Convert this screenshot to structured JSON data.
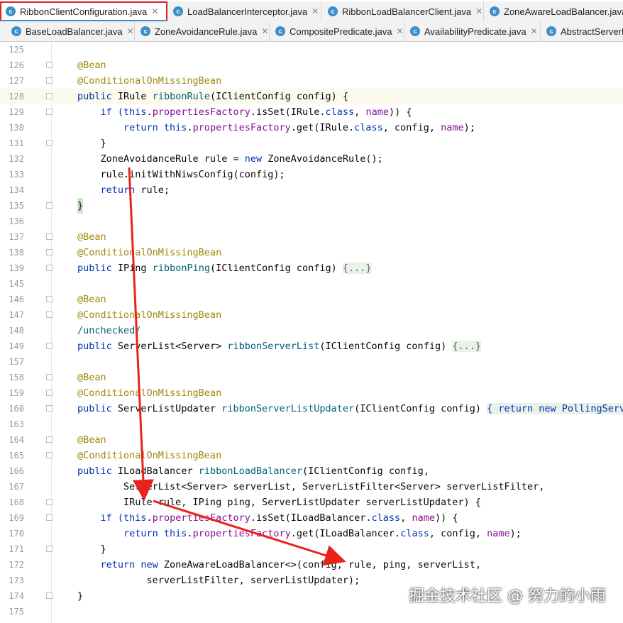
{
  "tabs_row1": [
    {
      "label": "RibbonClientConfiguration.java",
      "active": true
    },
    {
      "label": "LoadBalancerInterceptor.java"
    },
    {
      "label": "RibbonLoadBalancerClient.java"
    },
    {
      "label": "ZoneAwareLoadBalancer.java"
    }
  ],
  "tabs_row2": [
    {
      "label": "BaseLoadBalancer.java"
    },
    {
      "label": "ZoneAvoidanceRule.java"
    },
    {
      "label": "CompositePredicate.java"
    },
    {
      "label": "AvailabilityPredicate.java"
    },
    {
      "label": "AbstractServerP"
    }
  ],
  "line_numbers": [
    "125",
    "126",
    "127",
    "128",
    "129",
    "130",
    "131",
    "132",
    "133",
    "134",
    "135",
    "136",
    "137",
    "138",
    "139",
    "145",
    "146",
    "147",
    "148",
    "149",
    "157",
    "158",
    "159",
    "160",
    "163",
    "164",
    "165",
    "166",
    "167",
    "168",
    "169",
    "170",
    "171",
    "172",
    "173",
    "174",
    "175"
  ],
  "code": {
    "l126": "@Bean",
    "l127": "@ConditionalOnMissingBean",
    "l128_a": "public",
    "l128_b": " IRule ",
    "l128_c": "ribbonRule",
    "l128_d": "(IClientConfig config) {",
    "l129_a": "    if (",
    "l129_b": "this",
    "l129_c": ".",
    "l129_d": "propertiesFactory",
    "l129_e": ".isSet(IRule.",
    "l129_f": "class",
    "l129_g": ", ",
    "l129_h": "name",
    "l129_i": ")) {",
    "l130_a": "        return ",
    "l130_b": "this",
    "l130_c": ".",
    "l130_d": "propertiesFactory",
    "l130_e": ".get(IRule.",
    "l130_f": "class",
    "l130_g": ", config, ",
    "l130_h": "name",
    "l130_i": ");",
    "l131": "    }",
    "l132_a": "    ZoneAvoidanceRule rule = ",
    "l132_b": "new",
    "l132_c": " ZoneAvoidanceRule();",
    "l133": "    rule.initWithNiwsConfig(config);",
    "l134_a": "    return",
    "l134_b": " rule;",
    "l135": "}",
    "l137": "@Bean",
    "l138": "@ConditionalOnMissingBean",
    "l139_a": "public",
    "l139_b": " IPing ",
    "l139_c": "ribbonPing",
    "l139_d": "(IClientConfig config) ",
    "l139_e": "{...}",
    "l146": "@Bean",
    "l147": "@ConditionalOnMissingBean",
    "l148": "/unchecked/",
    "l149_a": "public",
    "l149_b": " ServerList<Server> ",
    "l149_c": "ribbonServerList",
    "l149_d": "(IClientConfig config) ",
    "l149_e": "{...}",
    "l158": "@Bean",
    "l159": "@ConditionalOnMissingBean",
    "l160_a": "public",
    "l160_b": " ServerListUpdater ",
    "l160_c": "ribbonServerListUpdater",
    "l160_d": "(IClientConfig config) ",
    "l160_e": "{ return new PollingServe",
    "l164": "@Bean",
    "l165": "@ConditionalOnMissingBean",
    "l166_a": "public",
    "l166_b": " ILoadBalancer ",
    "l166_c": "ribbonLoadBalancer",
    "l166_d": "(IClientConfig config,",
    "l167": "        ServerList<Server> serverList, ServerListFilter<Server> serverListFilter,",
    "l168": "        IRule rule, IPing ping, ServerListUpdater serverListUpdater) {",
    "l169_a": "    if (",
    "l169_b": "this",
    "l169_c": ".",
    "l169_d": "propertiesFactory",
    "l169_e": ".isSet(ILoadBalancer.",
    "l169_f": "class",
    "l169_g": ", ",
    "l169_h": "name",
    "l169_i": ")) {",
    "l170_a": "        return ",
    "l170_b": "this",
    "l170_c": ".",
    "l170_d": "propertiesFactory",
    "l170_e": ".get(ILoadBalancer.",
    "l170_f": "class",
    "l170_g": ", config, ",
    "l170_h": "name",
    "l170_i": ");",
    "l171": "    }",
    "l172_a": "    return ",
    "l172_b": "new",
    "l172_c": " ZoneAwareLoadBalancer<>(config, rule, ping, serverList,",
    "l173": "            serverListFilter, serverListUpdater);",
    "l174": "}"
  },
  "watermark": "掘金技术社区 @ 努力的小雨",
  "colors": {
    "arrow": "#e8231c",
    "tab_active_underline": "#4a88c7",
    "highlight_box": "#e02020"
  }
}
